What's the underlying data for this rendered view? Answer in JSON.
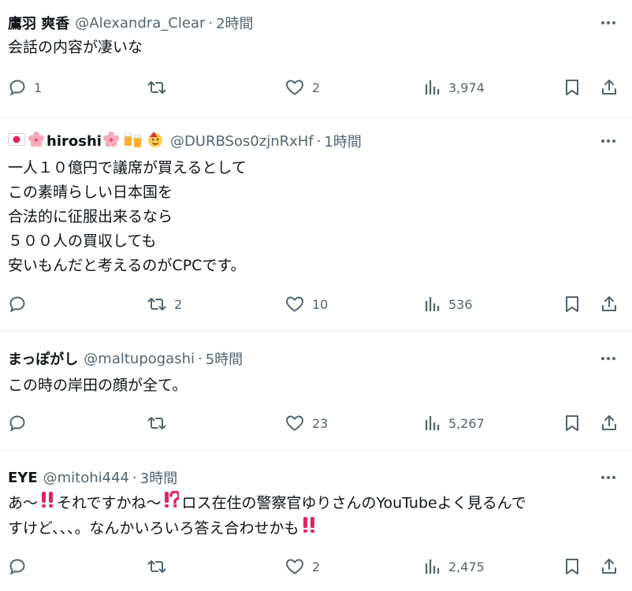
{
  "colors": {
    "text": "#0f1419",
    "secondary": "#536471",
    "divider": "#eff3f4",
    "warn_red": "#e0245e"
  },
  "tweets": [
    {
      "name": "鷹羽 爽香",
      "handle": "@Alexandra_Clear",
      "time": "2時間",
      "lines": [
        "会話の内容が凄いな"
      ],
      "stats": {
        "reply": "1",
        "retweet": "",
        "like": "2",
        "views": "3,974"
      }
    },
    {
      "name": "hiroshi",
      "name_icons": [
        "japan-flag-icon",
        "sakura-icon",
        "sakura-icon",
        "beer-mugs-icon",
        "party-face-icon"
      ],
      "handle": "@DURBSos0zjnRxHf",
      "time": "1時間",
      "lines": [
        "一人１０億円で議席が買えるとして",
        "この素晴らしい日本国を",
        "合法的に征服出来るなら",
        "５００人の買収しても",
        "安いもんだと考えるのがCPCです。"
      ],
      "stats": {
        "reply": "",
        "retweet": "2",
        "like": "10",
        "views": "536"
      }
    },
    {
      "name": "まっぽがし",
      "handle": "@maltupogashi",
      "time": "5時間",
      "lines": [
        "この時の岸田の顔が全て。"
      ],
      "stats": {
        "reply": "",
        "retweet": "",
        "like": "23",
        "views": "5,267"
      }
    },
    {
      "name": "EYE",
      "handle": "@mitohi444",
      "time": "3時間",
      "line1": {
        "a": "あ〜",
        "b": "それですかね〜",
        "c": "ロス在住の警察官ゆりさんのYouTubeよく見るんで"
      },
      "line2": {
        "a": "すけど、、、。なんかいろいろ答え合わせかも"
      },
      "stats": {
        "reply": "",
        "retweet": "",
        "like": "2",
        "views": "2,475"
      }
    }
  ]
}
